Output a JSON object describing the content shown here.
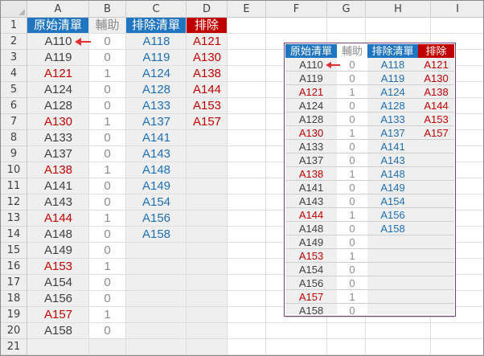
{
  "columns": [
    "A",
    "B",
    "C",
    "D",
    "E",
    "F",
    "G",
    "H",
    "I"
  ],
  "rows": [
    "1",
    "2",
    "3",
    "4",
    "5",
    "6",
    "7",
    "8",
    "9",
    "10",
    "11",
    "12",
    "13",
    "14",
    "15",
    "16",
    "17",
    "18",
    "19",
    "20",
    "21"
  ],
  "headers": {
    "original": "原始清單",
    "helper": "輔助",
    "exclude_list": "排除清單",
    "exclude": "排除"
  },
  "colors": {
    "blue_header_bg": "#1f75c0",
    "red_header_bg": "#c00000",
    "black_text": "#404040",
    "red_text": "#c00000",
    "blue_text": "#1f6fb5",
    "gray_text": "#8c8c8c",
    "table_border": "#7b3f74"
  },
  "original_list": [
    {
      "v": "A110",
      "red": false
    },
    {
      "v": "A119",
      "red": false
    },
    {
      "v": "A121",
      "red": true
    },
    {
      "v": "A124",
      "red": false
    },
    {
      "v": "A128",
      "red": false
    },
    {
      "v": "A130",
      "red": true
    },
    {
      "v": "A133",
      "red": false
    },
    {
      "v": "A137",
      "red": false
    },
    {
      "v": "A138",
      "red": true
    },
    {
      "v": "A141",
      "red": false
    },
    {
      "v": "A143",
      "red": false
    },
    {
      "v": "A144",
      "red": true
    },
    {
      "v": "A148",
      "red": false
    },
    {
      "v": "A149",
      "red": false
    },
    {
      "v": "A153",
      "red": true
    },
    {
      "v": "A154",
      "red": false
    },
    {
      "v": "A156",
      "red": false
    },
    {
      "v": "A157",
      "red": true
    },
    {
      "v": "A158",
      "red": false
    }
  ],
  "helper_list": [
    "0",
    "0",
    "1",
    "0",
    "0",
    "1",
    "0",
    "0",
    "1",
    "0",
    "0",
    "1",
    "0",
    "0",
    "1",
    "0",
    "0",
    "1",
    "0"
  ],
  "exclude_list": [
    "A118",
    "A119",
    "A124",
    "A128",
    "A133",
    "A137",
    "A141",
    "A143",
    "A148",
    "A149",
    "A154",
    "A156",
    "A158"
  ],
  "exclude": [
    "A121",
    "A130",
    "A138",
    "A144",
    "A153",
    "A157"
  ],
  "arrow_icon": "red-left-arrow"
}
